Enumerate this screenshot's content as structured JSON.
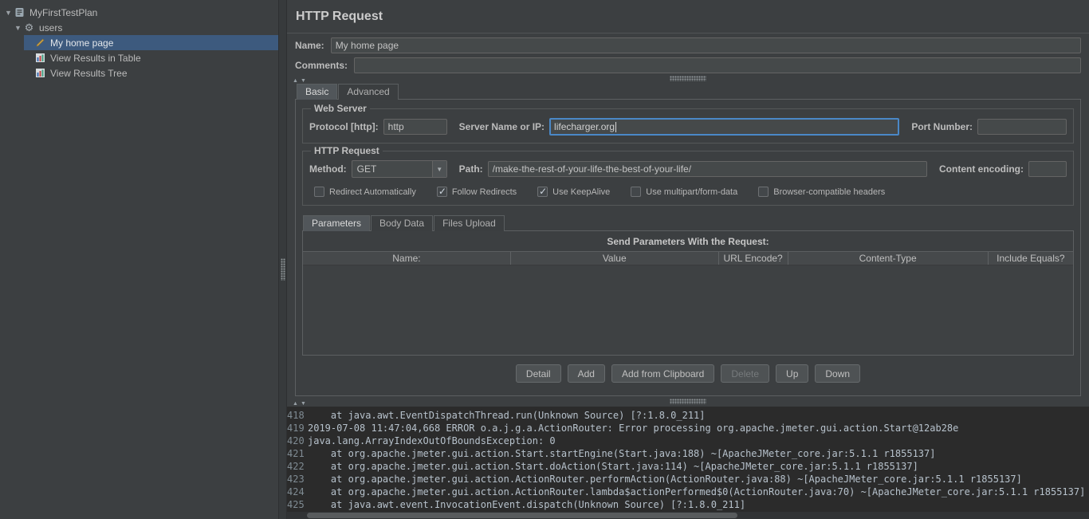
{
  "tree": {
    "items": [
      {
        "label": "MyFirstTestPlan",
        "level": 0,
        "icon": "test-plan",
        "expanded": true,
        "selected": false
      },
      {
        "label": "users",
        "level": 1,
        "icon": "thread-group",
        "expanded": true,
        "selected": false
      },
      {
        "label": "My home page",
        "level": 2,
        "icon": "http-sampler",
        "selected": true
      },
      {
        "label": "View Results in Table",
        "level": 2,
        "icon": "listener",
        "selected": false
      },
      {
        "label": "View Results Tree",
        "level": 2,
        "icon": "listener",
        "selected": false
      }
    ]
  },
  "main": {
    "title": "HTTP Request",
    "name": {
      "label": "Name:",
      "value": "My home page"
    },
    "comments": {
      "label": "Comments:",
      "value": ""
    },
    "tabs": [
      {
        "label": "Basic",
        "selected": true
      },
      {
        "label": "Advanced",
        "selected": false
      }
    ],
    "web_server": {
      "title": "Web Server",
      "protocol_label": "Protocol [http]:",
      "protocol_value": "http",
      "server_label": "Server Name or IP:",
      "server_value": "lifecharger.org",
      "port_label": "Port Number:",
      "port_value": ""
    },
    "http_request": {
      "title": "HTTP Request",
      "method_label": "Method:",
      "method_value": "GET",
      "path_label": "Path:",
      "path_value": "/make-the-rest-of-your-life-the-best-of-your-life/",
      "content_encoding_label": "Content encoding:",
      "content_encoding_value": "",
      "checkboxes": [
        {
          "label": "Redirect Automatically",
          "checked": false
        },
        {
          "label": "Follow Redirects",
          "checked": true
        },
        {
          "label": "Use KeepAlive",
          "checked": true
        },
        {
          "label": "Use multipart/form-data",
          "checked": false
        },
        {
          "label": "Browser-compatible headers",
          "checked": false
        }
      ]
    },
    "param_tabs": [
      {
        "label": "Parameters",
        "selected": true
      },
      {
        "label": "Body Data",
        "selected": false
      },
      {
        "label": "Files Upload",
        "selected": false
      }
    ],
    "params_table": {
      "title": "Send Parameters With the Request:",
      "columns": [
        "Name:",
        "Value",
        "URL Encode?",
        "Content-Type",
        "Include Equals?"
      ],
      "rows": []
    },
    "buttons": [
      {
        "label": "Detail",
        "disabled": false
      },
      {
        "label": "Add",
        "disabled": false
      },
      {
        "label": "Add from Clipboard",
        "disabled": false
      },
      {
        "label": "Delete",
        "disabled": true
      },
      {
        "label": "Up",
        "disabled": false
      },
      {
        "label": "Down",
        "disabled": false
      }
    ]
  },
  "log": {
    "lines": [
      {
        "num": "418",
        "text": "    at java.awt.EventDispatchThread.run(Unknown Source) [?:1.8.0_211]"
      },
      {
        "num": "419",
        "text": "2019-07-08 11:47:04,668 ERROR o.a.j.g.a.ActionRouter: Error processing org.apache.jmeter.gui.action.Start@12ab28e"
      },
      {
        "num": "420",
        "text": "java.lang.ArrayIndexOutOfBoundsException: 0"
      },
      {
        "num": "421",
        "text": "    at org.apache.jmeter.gui.action.Start.startEngine(Start.java:188) ~[ApacheJMeter_core.jar:5.1.1 r1855137]"
      },
      {
        "num": "422",
        "text": "    at org.apache.jmeter.gui.action.Start.doAction(Start.java:114) ~[ApacheJMeter_core.jar:5.1.1 r1855137]"
      },
      {
        "num": "423",
        "text": "    at org.apache.jmeter.gui.action.ActionRouter.performAction(ActionRouter.java:88) ~[ApacheJMeter_core.jar:5.1.1 r1855137]"
      },
      {
        "num": "424",
        "text": "    at org.apache.jmeter.gui.action.ActionRouter.lambda$actionPerformed$0(ActionRouter.java:70) ~[ApacheJMeter_core.jar:5.1.1 r1855137]"
      },
      {
        "num": "425",
        "text": "    at java.awt.event.InvocationEvent.dispatch(Unknown Source) [?:1.8.0_211]"
      }
    ]
  },
  "colors": {
    "background": "#3c3f41",
    "log_background": "#2b2b2b",
    "tree_selection": "#3d5a7e",
    "focus_border": "#4a88c7",
    "text": "#bbbbbb"
  }
}
